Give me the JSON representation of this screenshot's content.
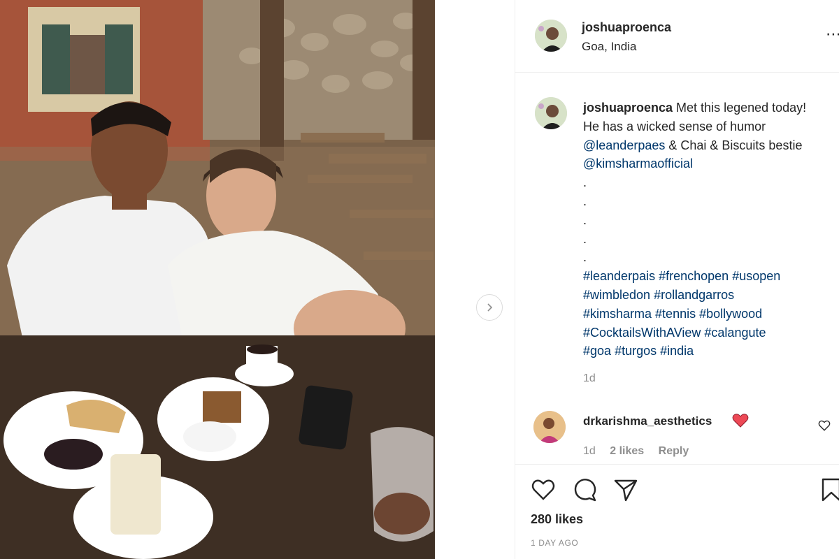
{
  "post": {
    "author": "joshuaproenca",
    "location": "Goa, India",
    "more_icon": "more-horizontal-icon"
  },
  "caption": {
    "author": "joshuaproenca",
    "text_1": "Met this legened today! He has a wicked sense of humor",
    "mention_1": "@leanderpaes",
    "text_2": "& Chai & Biscuits bestie",
    "mention_2": "@kimsharmaofficial",
    "dots": [
      ".",
      ".",
      ".",
      ".",
      "."
    ],
    "hashtags": [
      "#leanderpais",
      "#frenchopen",
      "#usopen",
      "#wimbledon",
      "#rollandgarros",
      "#kimsharma",
      "#tennis",
      "#bollywood",
      "#CocktailsWithAView",
      "#calangute",
      "#goa",
      "#turgos",
      "#india"
    ],
    "time": "1d"
  },
  "comment": {
    "author": "drkarishma_aesthetics",
    "time": "1d",
    "likes": "2 likes",
    "reply": "Reply"
  },
  "footer": {
    "likes": "280 likes",
    "date": "1 DAY AGO"
  },
  "colors": {
    "link": "#00376b",
    "muted": "#8e8e8e",
    "heart": "#ed4956"
  }
}
